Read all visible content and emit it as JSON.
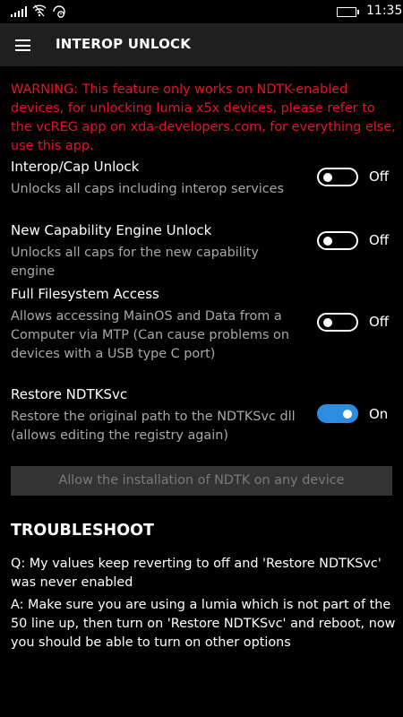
{
  "status_bar": {
    "time": "11:35",
    "icons": [
      "signal-icon",
      "wifi-icon",
      "data-saver-icon",
      "battery-icon"
    ]
  },
  "header": {
    "menu_icon": "hamburger-icon",
    "title": "INTEROP UNLOCK"
  },
  "warning": {
    "text": "WARNING: This feature only works on NDTK-enabled devices, for unlocking lumia x5x devices, please refer to the vcREG app on xda-developers.com, for everything else, use this app.",
    "color": "#e81123"
  },
  "settings": [
    {
      "title": "Interop/Cap Unlock",
      "description": "Unlocks all caps including interop services",
      "state": "Off",
      "on": false
    },
    {
      "title": "New Capability Engine Unlock",
      "description": "Unlocks all caps for the new capability engine",
      "state": "Off",
      "on": false
    },
    {
      "title": "Full Filesystem Access",
      "description": "Allows accessing MainOS and Data from a Computer via MTP (Can cause problems on devices with a USB type C port)",
      "state": "Off",
      "on": false
    },
    {
      "title": "Restore NDTKSvc",
      "description": "Restore the original path to the NDTKSvc dll (allows editing the registry again)",
      "state": "On",
      "on": true
    }
  ],
  "button": {
    "label": "Allow the installation of NDTK on any device"
  },
  "troubleshoot": {
    "heading": "TROUBLESHOOT",
    "question": "Q: My values keep reverting to off and 'Restore NDTKSvc' was never enabled",
    "answer": "A: Make sure you are using a lumia which is not part of the 50 line up, then turn on 'Restore NDTKSvc' and reboot, now you should be able to turn on other options"
  },
  "colors": {
    "accent": "#2b8ce0",
    "background": "#000000",
    "header": "#1f1f1f",
    "secondary_text": "#a8a8a8"
  }
}
